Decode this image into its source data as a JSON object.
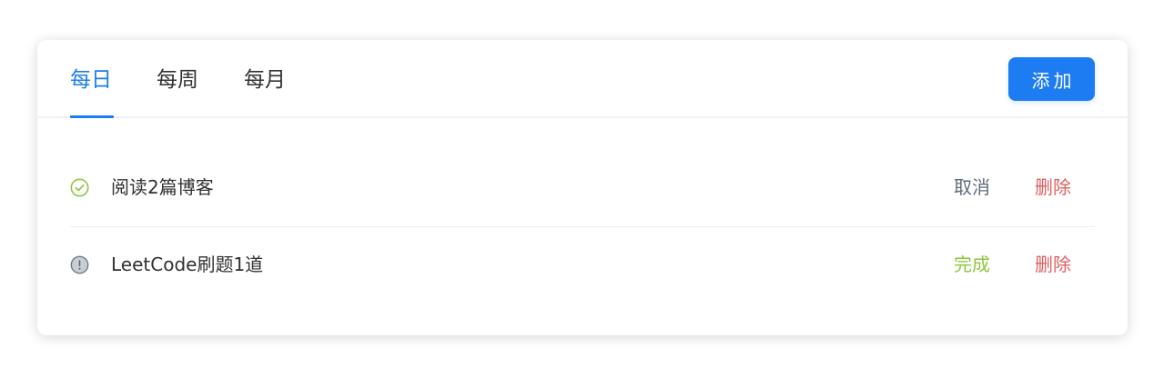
{
  "tabs": [
    {
      "label": "每日",
      "active": true
    },
    {
      "label": "每周",
      "active": false
    },
    {
      "label": "每月",
      "active": false
    }
  ],
  "add_button": {
    "label": "添加"
  },
  "colors": {
    "accent": "#1d7cf2",
    "done": "#8ec63f",
    "danger": "#e0605f",
    "muted": "#5f6b7a",
    "pending_icon": "#9aa3ad"
  },
  "tasks": [
    {
      "status": "completed",
      "status_icon": "check-circle-icon",
      "text": "阅读2篇博客",
      "primary_action": "取消",
      "delete_action": "删除"
    },
    {
      "status": "pending",
      "status_icon": "exclamation-circle-icon",
      "text": "LeetCode刷题1道",
      "primary_action": "完成",
      "delete_action": "删除"
    }
  ]
}
